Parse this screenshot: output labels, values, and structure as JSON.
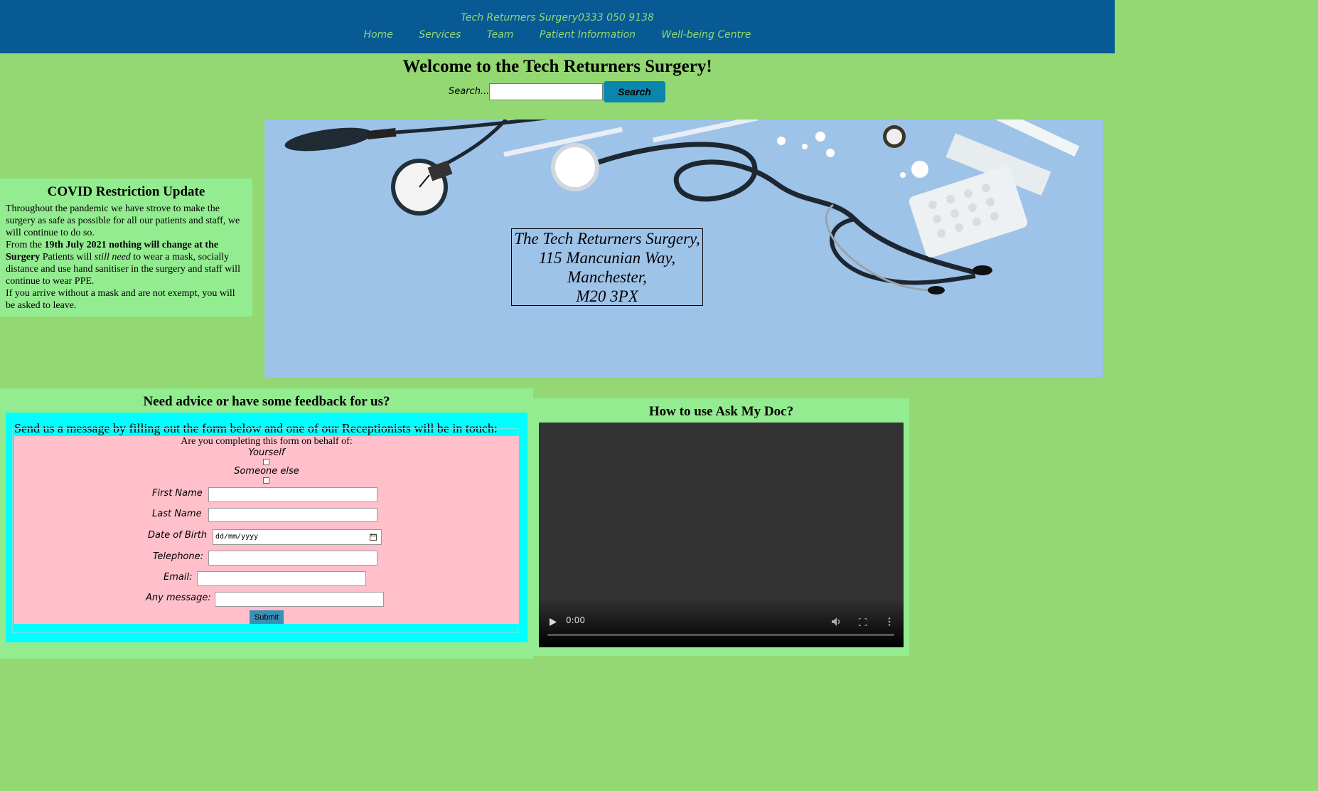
{
  "header": {
    "brand": "Tech Returners Surgery0333 050 9138",
    "nav": [
      "Home",
      "Services",
      "Team",
      "Patient Information",
      "Well-being Centre"
    ]
  },
  "welcome": "Welcome to the Tech Returners Surgery!",
  "search": {
    "label": "Search...",
    "value": "",
    "button": "Search"
  },
  "covid": {
    "title": "COVID Restriction Update",
    "p1": "Throughout the pandemic we have strove to make the surgery as safe as possible for all our patients and staff, we will continue to do so.",
    "p2_a": "From the ",
    "p2_b": "19th July 2021 nothing will change at the Surgery",
    "p2_c": " Patients will ",
    "p2_d": "still need",
    "p2_e": " to wear a mask, socially distance and use hand sanitiser in the surgery and staff will continue to wear PPE.",
    "p3": "If you arrive without a mask and are not exempt, you will be asked to leave."
  },
  "hero": {
    "address": [
      "The Tech Returners Surgery,",
      "115 Mancunian Way,",
      "Manchester,",
      "M20 3PX"
    ]
  },
  "advice": {
    "title": "Need advice or have some feedback for us?",
    "intro": "Send us a message by filling out the form below and one of our Receptionists will be in touch:",
    "behalf_question": "Are you completing this form on behalf of:",
    "option_yourself": "Yourself",
    "option_someone": "Someone else",
    "first_name": "First Name",
    "last_name": "Last Name",
    "dob": "Date of Birth",
    "dob_placeholder": "dd/mm/yyyy",
    "telephone": "Telephone:",
    "email": "Email:",
    "message": "Any message:",
    "submit": "Submit"
  },
  "askdoc": {
    "title": "How to use Ask My Doc?",
    "video_time": "0:00"
  },
  "icons": {
    "calendar": "calendar-icon",
    "play": "play-icon",
    "volume": "volume-icon",
    "fullscreen": "fullscreen-icon",
    "more": "more-icon"
  },
  "colors": {
    "header_bg": "#075a94",
    "page_bg": "#93d872",
    "panel_bg": "#93ec90",
    "form_outer": "#00ffff",
    "form_inner": "#ffc0cb",
    "search_button": "#0a86ad"
  }
}
